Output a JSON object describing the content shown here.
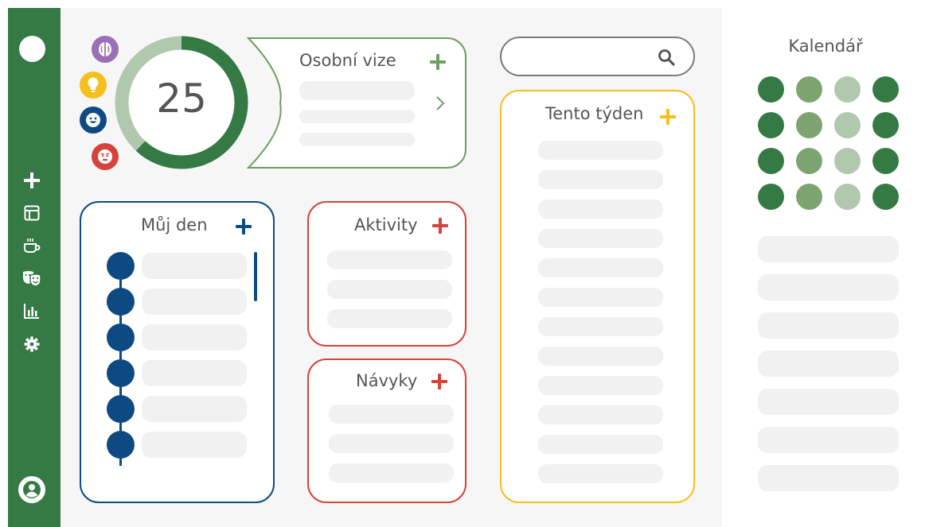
{
  "sidebar": {
    "icons": [
      "logo-icon",
      "plus-icon",
      "layout-icon",
      "coffee-icon",
      "theater-masks-icon",
      "bar-chart-icon",
      "gear-icon",
      "user-icon"
    ],
    "bg_color": "#357a44"
  },
  "moods": [
    {
      "icon": "brain-icon",
      "color": "#9b6fb5"
    },
    {
      "icon": "lightbulb-icon",
      "color": "#f6bf1b"
    },
    {
      "icon": "smile-icon",
      "color": "#0e4a82"
    },
    {
      "icon": "angry-icon",
      "color": "#d6433a"
    }
  ],
  "score": {
    "value": "25",
    "progress": 0.62,
    "color": "#357a44",
    "track_color": "#b0c8ad"
  },
  "vision": {
    "title": "Osobní vize",
    "accent": "#6e9e62"
  },
  "search": {
    "placeholder": "",
    "value": ""
  },
  "this_week": {
    "title": "Tento týden",
    "accent": "#f6bf1b"
  },
  "my_day": {
    "title": "Můj den",
    "accent": "#0e4a82"
  },
  "activities": {
    "title": "Aktivity",
    "accent": "#d6433a"
  },
  "habits": {
    "title": "Návyky",
    "accent": "#d6433a"
  },
  "calendar": {
    "title": "Kalendář",
    "dot_colors": [
      "#357a44",
      "#7da46f",
      "#b0c8ad",
      "#357a44"
    ]
  }
}
